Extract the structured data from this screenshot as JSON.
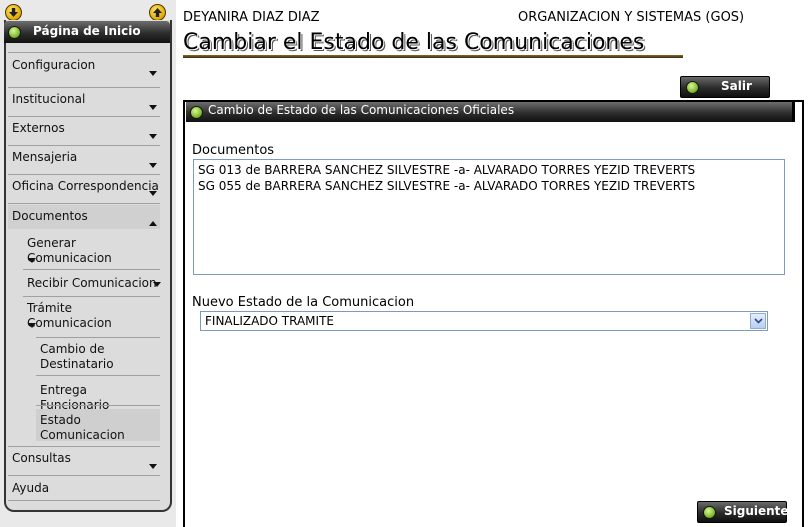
{
  "sidebar": {
    "home_title": "Página de Inicio",
    "items": [
      {
        "label": "Configuracion"
      },
      {
        "label": "Institucional"
      },
      {
        "label": "Externos"
      },
      {
        "label": "Mensajeria"
      },
      {
        "label": "Oficina Correspondencia"
      },
      {
        "label": "Documentos"
      },
      {
        "label": "Generar Comunicacion"
      },
      {
        "label": "Recibir Comunicacion"
      },
      {
        "label": "Trámite Comunicacion"
      },
      {
        "label": "Cambio de Destinatario"
      },
      {
        "label": "Entrega Funcionario"
      },
      {
        "label": "Estado Comunicacion"
      },
      {
        "label": "Consultas"
      },
      {
        "label": "Ayuda"
      }
    ]
  },
  "header": {
    "user_name": "DEYANIRA DIAZ DIAZ",
    "organization": "ORGANIZACION Y SISTEMAS (GOS)",
    "page_title": "Cambiar el Estado de las Comunicaciones"
  },
  "toolbar": {
    "exit_label": "Salir",
    "next_label": "Siguiente"
  },
  "panel": {
    "title": "Cambio de Estado de las Comunicaciones Oficiales",
    "documents_label": "Documentos",
    "documents": [
      "SG 013 de BARRERA SANCHEZ SILVESTRE -a- ALVARADO TORRES YEZID TREVERTS",
      "SG 055 de BARRERA SANCHEZ SILVESTRE -a- ALVARADO TORRES YEZID TREVERTS"
    ],
    "status_label": "Nuevo Estado de la Comunicacion",
    "status_value": "FINALIZADO TRAMITE"
  },
  "icons": {
    "corner_left": "arrow-down-circle-icon",
    "corner_right": "arrow-up-circle-icon",
    "lamp": "green-lamp-icon"
  },
  "colors": {
    "bar_dark": "#2d2d2d",
    "lamp_green": "#7fb52a",
    "sidebar_bg": "#dcdcdc",
    "selected_item": "#cfcfcf"
  }
}
